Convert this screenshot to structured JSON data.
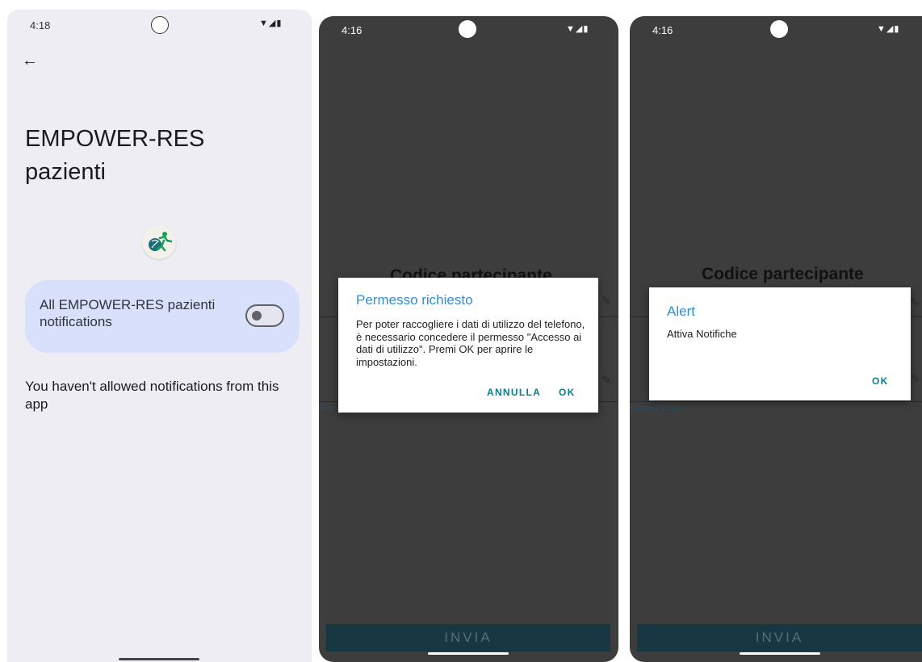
{
  "screen1": {
    "status_time": "4:18",
    "status_icons": "▼◢▮",
    "back_icon": "←",
    "app_title": "EMPOWER-RES pazienti",
    "channel_label": "All EMPOWER-RES pazienti notifications",
    "toggle_on": false,
    "notice": "You haven't allowed notifications from this app"
  },
  "screen2": {
    "status_time": "4:16",
    "status_icons": "▼◢▮",
    "bg_title": "Codice partecipante",
    "privacy": "Priv",
    "submit_label": "INVIA",
    "dialog": {
      "title": "Permesso richiesto",
      "body": "Per poter raccogliere i dati di utilizzo del telefono, è necessario concedere il permesso \"Accesso ai dati di utilizzo\". Premi OK per aprire le impostazioni.",
      "cancel_label": "ANNULLA",
      "ok_label": "OK"
    }
  },
  "screen3": {
    "status_time": "4:16",
    "status_icons": "▼◢▮",
    "bg_title": "Codice partecipante",
    "privacy": "Privacy Policy",
    "submit_label": "INVIA",
    "dialog": {
      "title": "Alert",
      "body": "Attiva Notifiche",
      "ok_label": "OK"
    }
  },
  "colors": {
    "settings_bg": "#efedf4",
    "card_bg": "#d9e0fc",
    "dialog_title": "#2f8fd3",
    "dialog_button": "#0b7e8e",
    "submit_bg": "#173743"
  }
}
